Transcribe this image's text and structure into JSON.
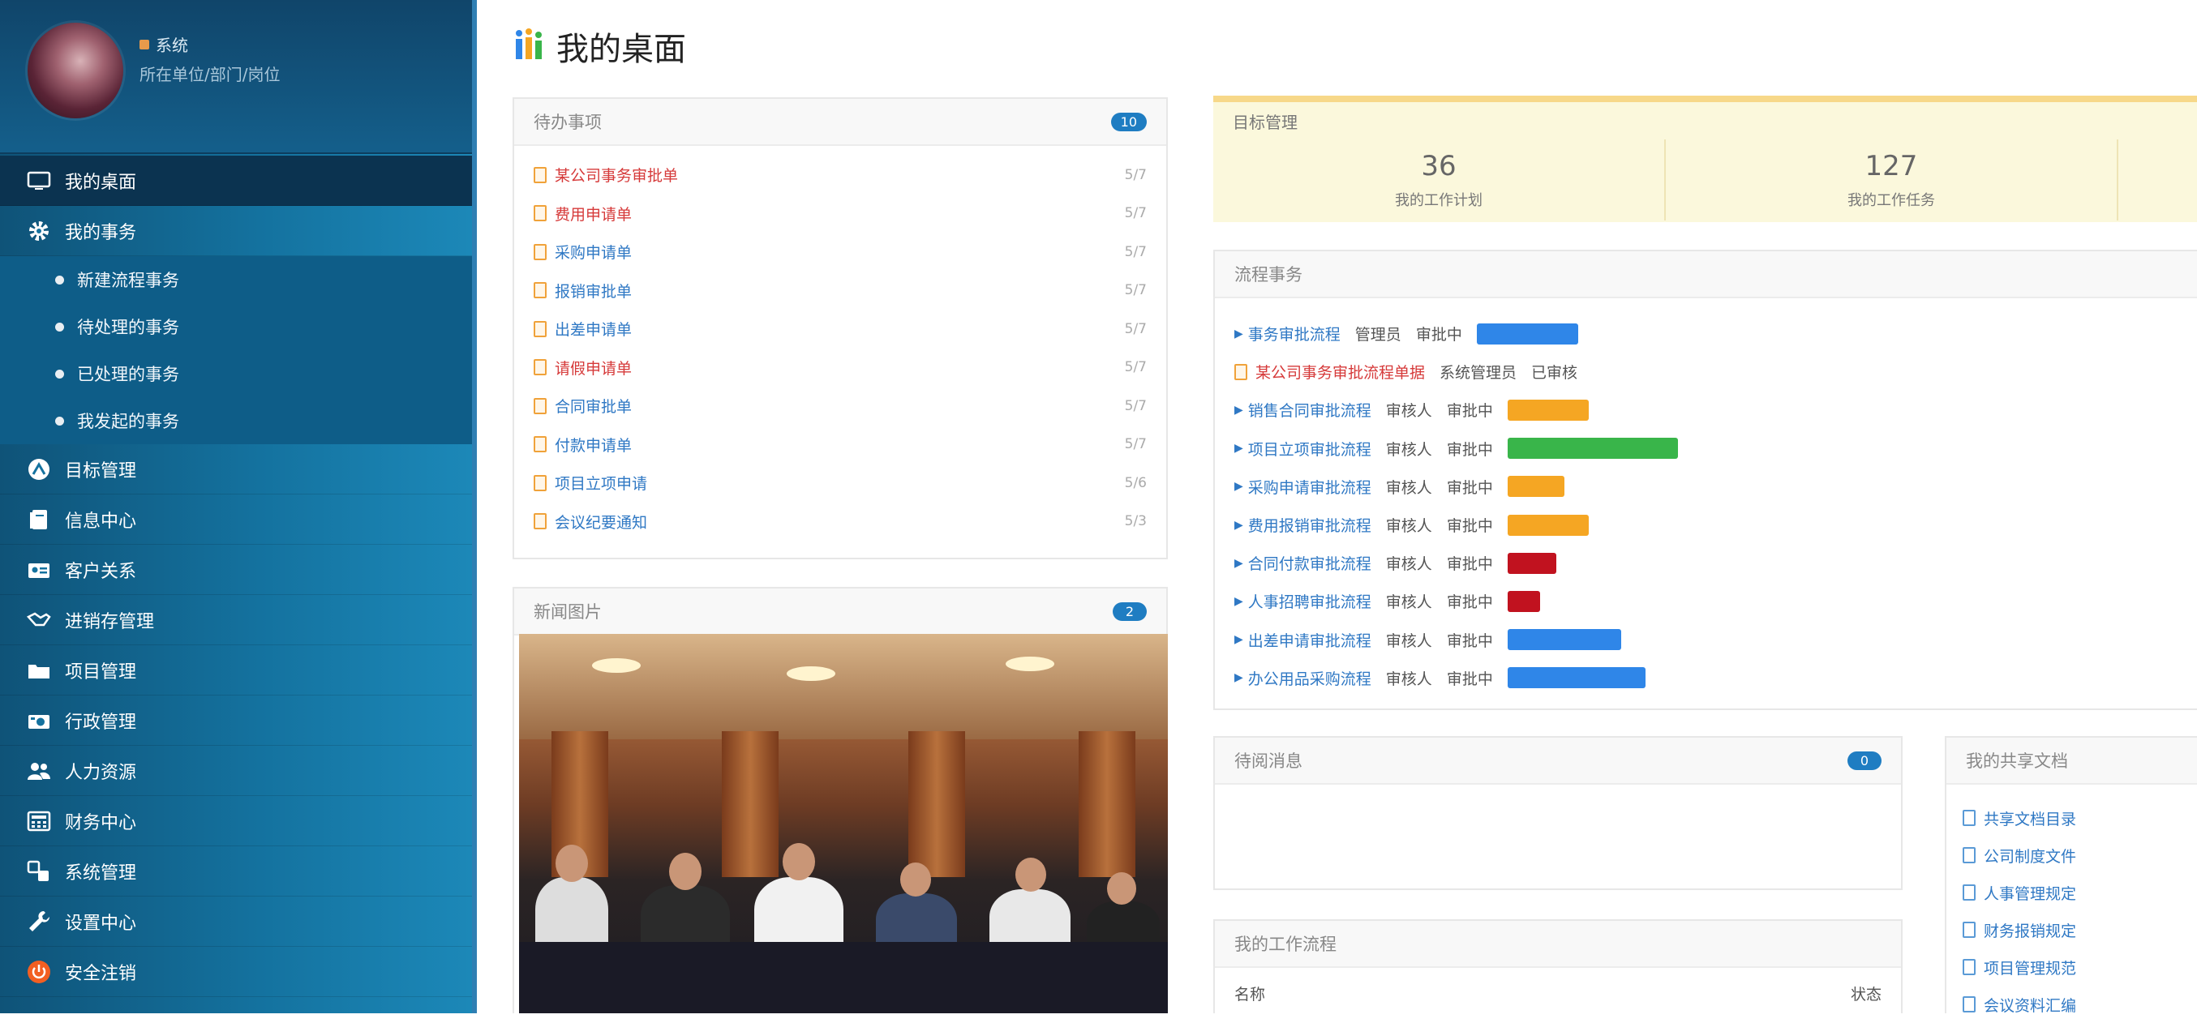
{
  "colors": {
    "sidebar_dark": "#0f5378",
    "sidebar_active": "#0b3350",
    "accent_blue": "#1f7dc2",
    "link_blue": "#2f78c4",
    "alert_red": "#d63a3a",
    "bar_blue": "#2f86e8",
    "bar_orange": "#f5a623",
    "bar_green": "#39b54a",
    "bar_darkred": "#c1121f"
  },
  "profile": {
    "name": "系统",
    "department": "所在单位/部门/岗位"
  },
  "sidebar": {
    "items": [
      {
        "label": "我的桌面",
        "icon": "monitor-icon"
      },
      {
        "label": "我的事务",
        "icon": "gear-icon"
      },
      {
        "label": "目标管理",
        "icon": "target-icon"
      },
      {
        "label": "信息中心",
        "icon": "document-stack-icon"
      },
      {
        "label": "客户关系",
        "icon": "contact-card-icon"
      },
      {
        "label": "进销存管理",
        "icon": "handshake-icon"
      },
      {
        "label": "项目管理",
        "icon": "folder-icon"
      },
      {
        "label": "行政管理",
        "icon": "camera-icon"
      },
      {
        "label": "人力资源",
        "icon": "users-icon"
      },
      {
        "label": "财务中心",
        "icon": "calculator-icon"
      },
      {
        "label": "系统管理",
        "icon": "system-icon"
      },
      {
        "label": "设置中心",
        "icon": "wrench-icon"
      },
      {
        "label": "安全注销",
        "icon": "power-icon"
      }
    ],
    "sub_items": [
      {
        "label": "新建流程事务"
      },
      {
        "label": "待处理的事务"
      },
      {
        "label": "已处理的事务"
      },
      {
        "label": "我发起的事务"
      }
    ]
  },
  "page": {
    "title": "我的桌面"
  },
  "todo_panel": {
    "title": "待办事项",
    "count": "10",
    "items": [
      {
        "text": "某公司事务审批单",
        "date": "5/7",
        "tone": "red"
      },
      {
        "text": "费用申请单",
        "date": "5/7",
        "tone": "red"
      },
      {
        "text": "采购申请单",
        "date": "5/7",
        "tone": "blue"
      },
      {
        "text": "报销审批单",
        "date": "5/7",
        "tone": "blue"
      },
      {
        "text": "出差申请单",
        "date": "5/7",
        "tone": "blue"
      },
      {
        "text": "请假申请单",
        "date": "5/7",
        "tone": "red"
      },
      {
        "text": "合同审批单",
        "date": "5/7",
        "tone": "blue"
      },
      {
        "text": "付款申请单",
        "date": "5/7",
        "tone": "blue"
      },
      {
        "text": "项目立项申请",
        "date": "5/6",
        "tone": "blue"
      },
      {
        "text": "会议纪要通知",
        "date": "5/3",
        "tone": "blue"
      }
    ]
  },
  "news_panel": {
    "title": "新闻图片",
    "count": "2"
  },
  "stats_panel": {
    "title": "目标管理",
    "stats": [
      {
        "value": "36",
        "label": "我的工作计划"
      },
      {
        "value": "127",
        "label": "我的工作任务"
      }
    ]
  },
  "process_panel": {
    "title": "流程事务",
    "items": [
      {
        "text": "事务审批流程",
        "person": "管理员",
        "step": "审批中",
        "bar_color": "#2f86e8",
        "bar_fraction": 0.25,
        "icon": "arrow"
      },
      {
        "text": "某公司事务审批流程单据",
        "person": "系统管理员",
        "step": "已审核",
        "bar_color": null,
        "bar_fraction": 0,
        "icon": "file"
      },
      {
        "text": "销售合同审批流程",
        "person": "审核人",
        "step": "审批中",
        "bar_color": "#f5a623",
        "bar_fraction": 0.2,
        "icon": "arrow"
      },
      {
        "text": "项目立项审批流程",
        "person": "审核人",
        "step": "审批中",
        "bar_color": "#39b54a",
        "bar_fraction": 0.42,
        "icon": "arrow"
      },
      {
        "text": "采购申请审批流程",
        "person": "审核人",
        "step": "审批中",
        "bar_color": "#f5a623",
        "bar_fraction": 0.14,
        "icon": "arrow"
      },
      {
        "text": "费用报销审批流程",
        "person": "审核人",
        "step": "审批中",
        "bar_color": "#f5a623",
        "bar_fraction": 0.2,
        "icon": "arrow"
      },
      {
        "text": "合同付款审批流程",
        "person": "审核人",
        "step": "审批中",
        "bar_color": "#c1121f",
        "bar_fraction": 0.12,
        "icon": "arrow"
      },
      {
        "text": "人事招聘审批流程",
        "person": "审核人",
        "step": "审批中",
        "bar_color": "#c1121f",
        "bar_fraction": 0.08,
        "icon": "arrow"
      },
      {
        "text": "出差申请审批流程",
        "person": "审核人",
        "step": "审批中",
        "bar_color": "#2f86e8",
        "bar_fraction": 0.28,
        "icon": "arrow"
      },
      {
        "text": "办公用品采购流程",
        "person": "审核人",
        "step": "审批中",
        "bar_color": "#2f86e8",
        "bar_fraction": 0.34,
        "icon": "arrow"
      }
    ]
  },
  "message_panel": {
    "title": "待阅消息",
    "count": "0"
  },
  "workflow_panel": {
    "title": "我的工作流程",
    "row_left": "名称",
    "row_right": "状态"
  },
  "share_panel": {
    "title": "我的共享文档",
    "items": [
      {
        "text": "共享文档目录"
      },
      {
        "text": "公司制度文件"
      },
      {
        "text": "人事管理规定"
      },
      {
        "text": "财务报销规定"
      },
      {
        "text": "项目管理规范"
      },
      {
        "text": "会议资料汇编"
      }
    ]
  }
}
